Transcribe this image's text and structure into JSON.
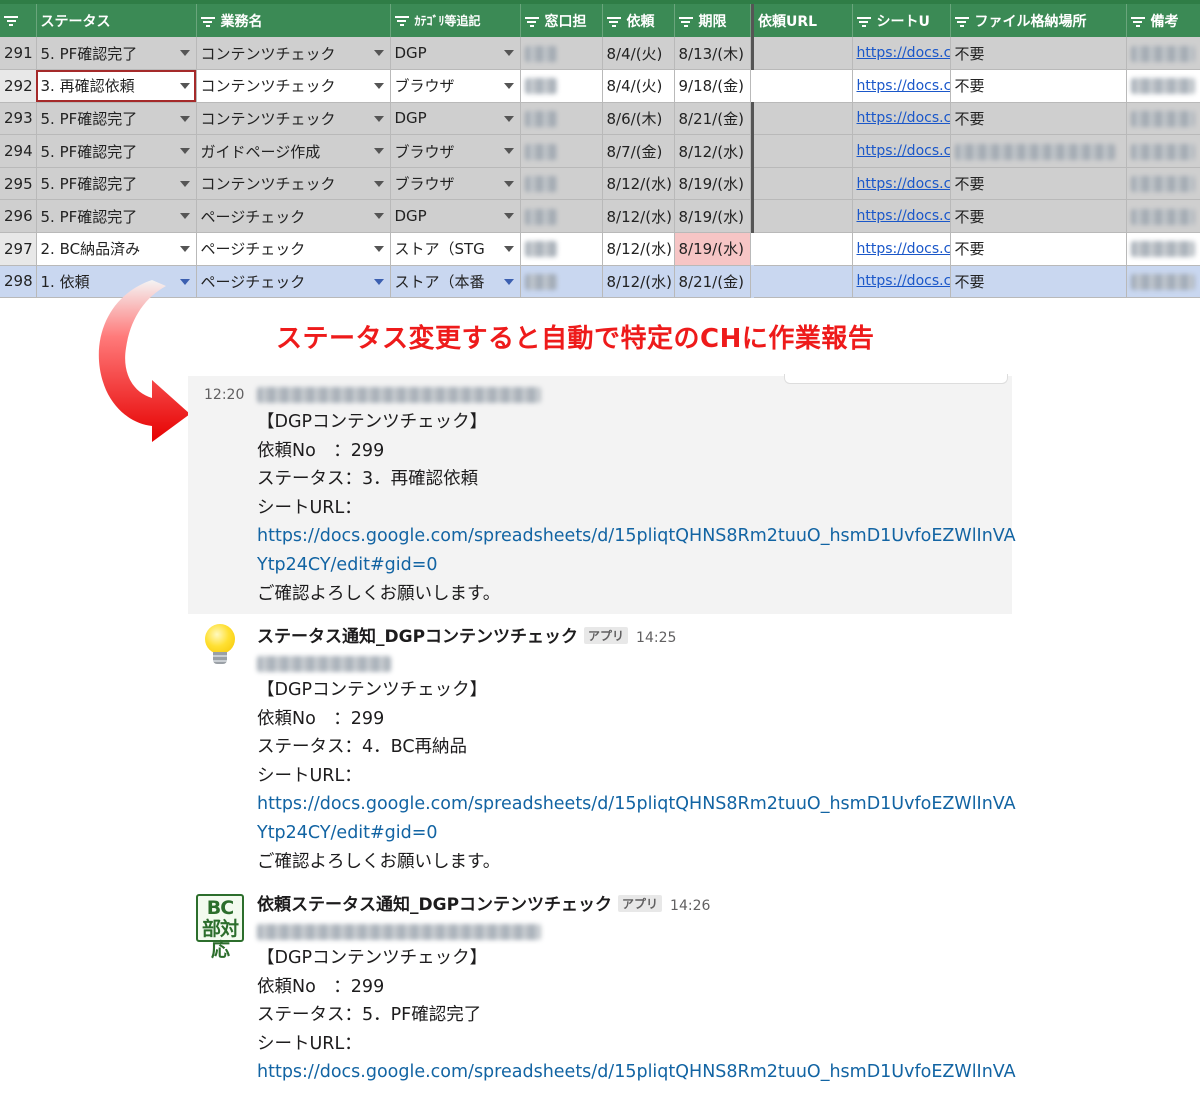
{
  "sheet": {
    "headers": [
      "ステータス",
      "業務名",
      "ｶﾃｺﾞﾘ等追記",
      "窓口担",
      "依頼",
      "期限",
      "依頼URL",
      "シートU",
      "ファイル格納場所",
      "備考"
    ],
    "rows": [
      {
        "no": "291",
        "status": "5. PF確認完了",
        "task": "コンテンツチェック",
        "category": "DGP",
        "req": "8/4/(火)",
        "due": "8/13/(木)",
        "link": "https://docs.c",
        "file": "不要"
      },
      {
        "no": "292",
        "status": "3. 再確認依頼",
        "task": "コンテンツチェック",
        "category": "ブラウザ",
        "req": "8/4/(火)",
        "due": "9/18/(金)",
        "link": "https://docs.c",
        "file": "不要"
      },
      {
        "no": "293",
        "status": "5. PF確認完了",
        "task": "コンテンツチェック",
        "category": "DGP",
        "req": "8/6/(木)",
        "due": "8/21/(金)",
        "link": "https://docs.c",
        "file": "不要"
      },
      {
        "no": "294",
        "status": "5. PF確認完了",
        "task": "ガイドページ作成",
        "category": "ブラウザ",
        "req": "8/7/(金)",
        "due": "8/12/(水)",
        "link": "https://docs.c",
        "file": ""
      },
      {
        "no": "295",
        "status": "5. PF確認完了",
        "task": "コンテンツチェック",
        "category": "ブラウザ",
        "req": "8/12/(水)",
        "due": "8/19/(水)",
        "link": "https://docs.c",
        "file": "不要"
      },
      {
        "no": "296",
        "status": "5. PF確認完了",
        "task": "ページチェック",
        "category": "DGP",
        "req": "8/12/(水)",
        "due": "8/19/(水)",
        "link": "https://docs.c",
        "file": "不要"
      },
      {
        "no": "297",
        "status": "2. BC納品済み",
        "task": "ページチェック",
        "category": "ストア（STG",
        "req": "8/12/(水)",
        "due": "8/19/(水)",
        "link": "https://docs.c",
        "file": "不要"
      },
      {
        "no": "298",
        "status": "1. 依頼",
        "task": "ページチェック",
        "category": "ストア（本番",
        "req": "8/12/(水)",
        "due": "8/21/(金)",
        "link": "https://docs.c",
        "file": "不要"
      }
    ]
  },
  "caption": "ステータス変更すると自動で特定のCHに作業報告",
  "messages": [
    {
      "time": "12:20",
      "lines": [
        "【DGPコンテンツチェック】",
        "依頼No　：299",
        "ステータス：3．再確認依頼",
        "シートURL：",
        "https://docs.google.com/spreadsheets/d/15pliqtQHNS8Rm2tuuO_hsmD1UvfoEZWlInVA",
        "Ytp24CY/edit#gid=0",
        "ご確認よろしくお願いします。"
      ]
    },
    {
      "sender": "ステータス通知_DGPコンテンツチェック",
      "badge": "アプリ",
      "time": "14:25",
      "avatar": "lightbulb-icon",
      "lines": [
        "【DGPコンテンツチェック】",
        "依頼No　：299",
        "ステータス：4．BC再納品",
        "シートURL：",
        "https://docs.google.com/spreadsheets/d/15pliqtQHNS8Rm2tuuO_hsmD1UvfoEZWlInVA",
        "Ytp24CY/edit#gid=0",
        "ご確認よろしくお願いします。"
      ]
    },
    {
      "sender": "依頼ステータス通知_DGPコンテンツチェック",
      "badge": "アプリ",
      "time": "14:26",
      "avatar_text": "BC部対応",
      "lines": [
        "【DGPコンテンツチェック】",
        "依頼No　：299",
        "ステータス：5．PF確認完了",
        "シートURL：",
        "https://docs.google.com/spreadsheets/d/15pliqtQHNS8Rm2tuuO_hsmD1UvfoEZWlInVA"
      ]
    }
  ],
  "colors": {
    "header_green": "#3b8a55",
    "caption_red": "#ee1b1b",
    "link_blue": "#1264a3",
    "selected_row": "#c9d7f0"
  }
}
